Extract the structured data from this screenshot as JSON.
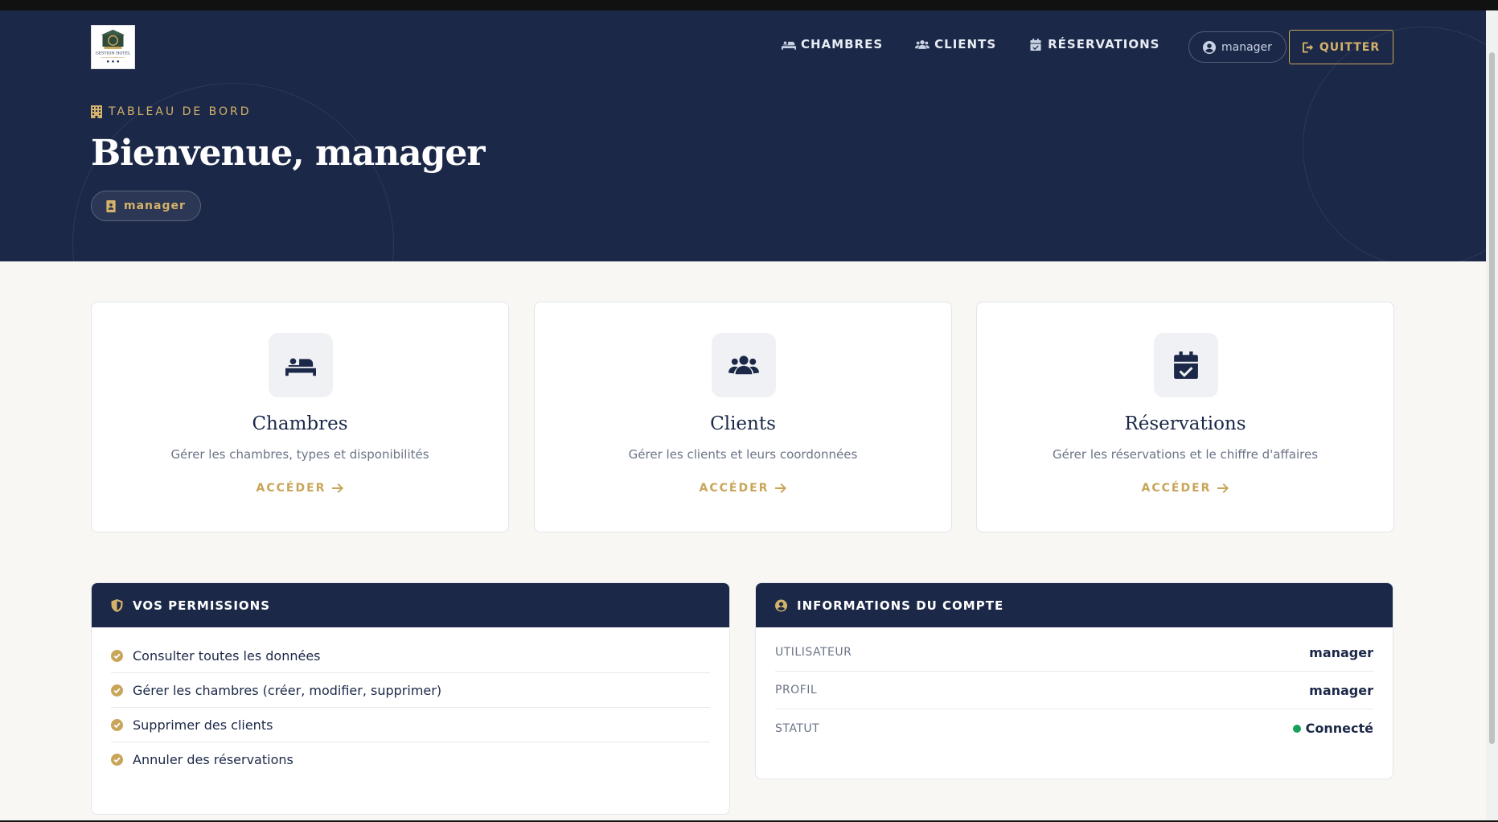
{
  "header": {
    "logo_text": "GESTION HOTEL",
    "nav": [
      {
        "label": "CHAMBRES",
        "icon": "bed-icon"
      },
      {
        "label": "CLIENTS",
        "icon": "users-icon"
      },
      {
        "label": "RÉSERVATIONS",
        "icon": "calendar-check-icon"
      }
    ],
    "user": "manager",
    "quit_label": "QUITTER",
    "eyebrow": "TABLEAU DE BORD",
    "title": "Bienvenue, manager",
    "role": "manager"
  },
  "cards": [
    {
      "title": "Chambres",
      "desc": "Gérer les chambres, types et disponibilités",
      "action": "ACCÉDER",
      "icon": "bed-icon"
    },
    {
      "title": "Clients",
      "desc": "Gérer les clients et leurs coordonnées",
      "action": "ACCÉDER",
      "icon": "users-icon"
    },
    {
      "title": "Réservations",
      "desc": "Gérer les réservations et le chiffre d'affaires",
      "action": "ACCÉDER",
      "icon": "calendar-check-icon"
    }
  ],
  "permissions": {
    "title": "VOS PERMISSIONS",
    "items": [
      "Consulter toutes les données",
      "Gérer les chambres (créer, modifier, supprimer)",
      "Supprimer des clients",
      "Annuler des réservations"
    ]
  },
  "account": {
    "title": "INFORMATIONS DU COMPTE",
    "rows": [
      {
        "label": "UTILISATEUR",
        "value": "manager"
      },
      {
        "label": "PROFIL",
        "value": "manager"
      },
      {
        "label": "STATUT",
        "value": "Connecté"
      }
    ]
  },
  "colors": {
    "navy": "#1b2848",
    "gold": "#c9a55a",
    "background": "#f8f7f4",
    "status_online": "#16a05a"
  }
}
